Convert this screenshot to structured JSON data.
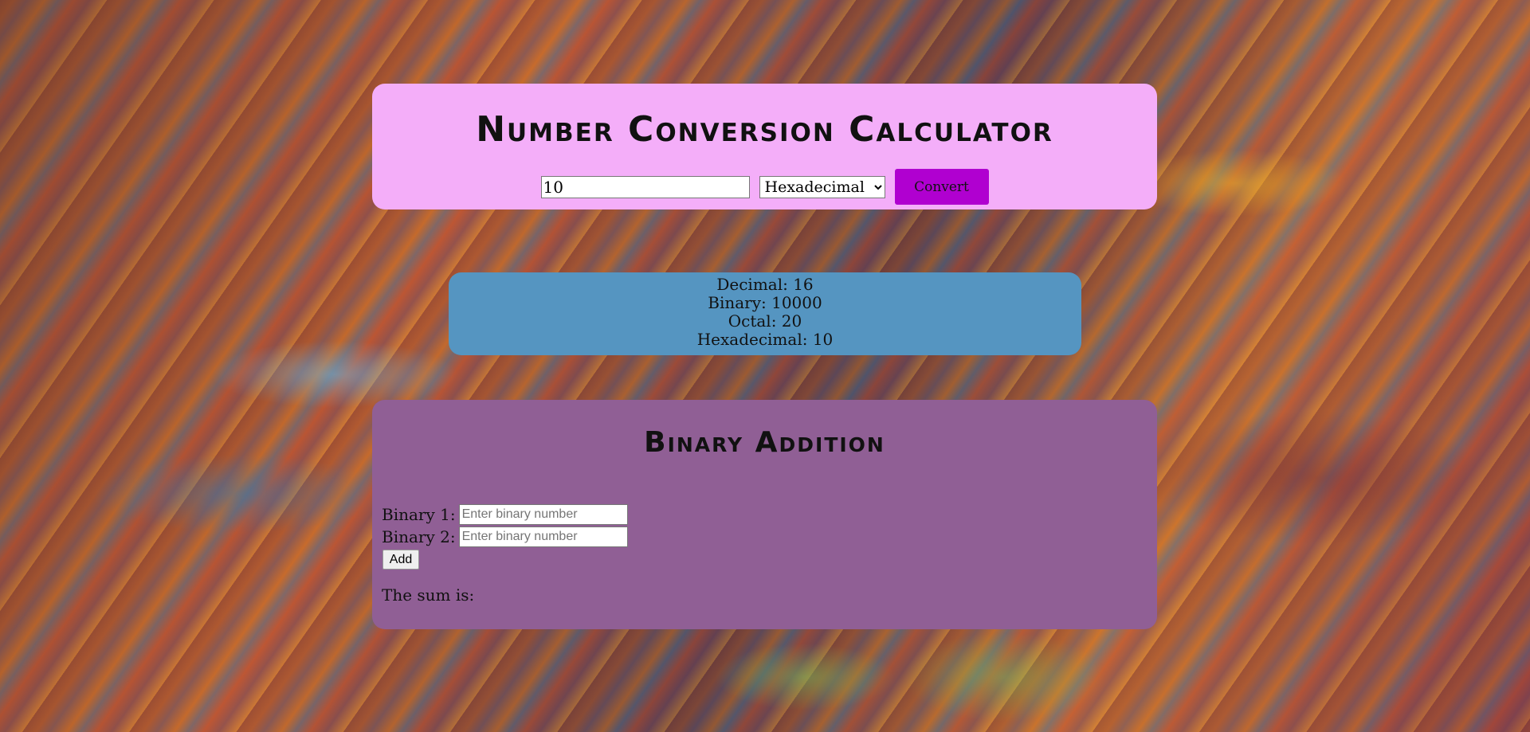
{
  "converter": {
    "title": "Number Conversion Calculator",
    "input_value": "10",
    "base_selected": "Hexadecimal",
    "convert_label": "Convert"
  },
  "results": {
    "decimal": "Decimal: 16",
    "binary": "Binary: 10000",
    "octal": "Octal: 20",
    "hexadecimal": "Hexadecimal: 10"
  },
  "binary_addition": {
    "title": "Binary Addition",
    "binary1_label": "Binary 1:",
    "binary1_placeholder": "Enter binary number",
    "binary2_label": "Binary 2:",
    "binary2_placeholder": "Enter binary number",
    "add_label": "Add",
    "sum_label": "The sum is:"
  },
  "colors": {
    "converter_panel": "#f4aef9",
    "convert_button": "#b000d0",
    "results_panel": "#5595c1",
    "binary_panel": "#905f95"
  }
}
